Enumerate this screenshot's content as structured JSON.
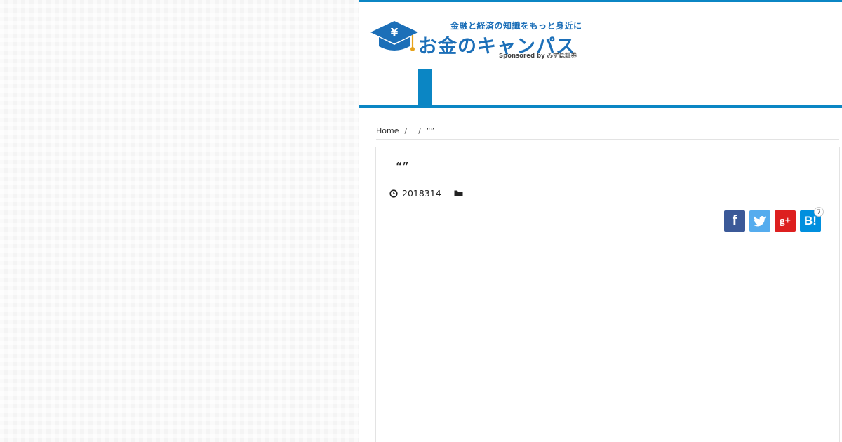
{
  "site": {
    "logo": {
      "tagline": "金融と経済の知識をもっと身近に",
      "title": "お金のキャンパス",
      "sponsor": "Sponsored by みずほ証券",
      "icon": "graduation-cap-yen-icon"
    },
    "colors": {
      "accent": "#0b86c4",
      "logo_blue": "#1c6fb8",
      "facebook": "#3b5998",
      "twitter": "#55acee",
      "google_plus": "#dd1f1f",
      "hatena": "#008fde"
    }
  },
  "breadcrumb": {
    "items": [
      "Home",
      "",
      "“”"
    ],
    "separator": "/"
  },
  "post": {
    "title": "“”",
    "date": "2018314",
    "date_icon": "clock-icon",
    "category_icon": "folder-icon"
  },
  "share": {
    "facebook_label": "f",
    "twitter_icon": "twitter-bird-icon",
    "google_plus_label": "g+",
    "hatena_label": "B!",
    "hatena_count": "7"
  }
}
